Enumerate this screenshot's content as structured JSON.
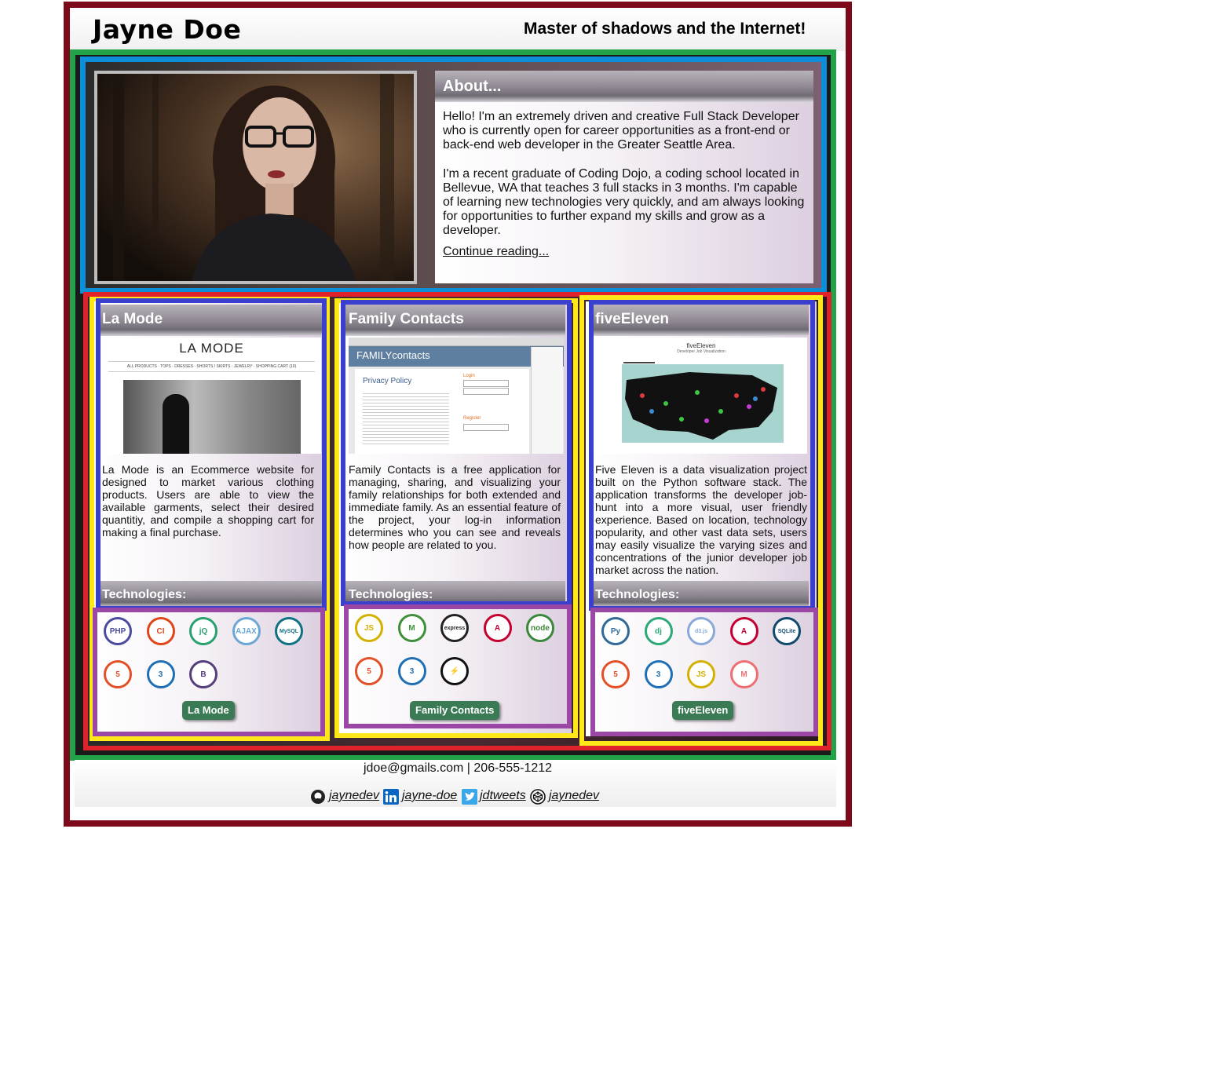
{
  "header": {
    "name": "Jayne Doe",
    "tagline": "Master of shadows and the Internet!"
  },
  "about": {
    "heading": "About...",
    "paragraph1": "Hello! I'm an extremely driven and creative Full Stack Developer who is currently open for career opportunities as a front-end or back-end web developer in the Greater Seattle Area.",
    "paragraph2": "I'm a recent graduate of Coding Dojo, a coding school located in Bellevue, WA that teaches 3 full stacks in 3 months. I'm capable of learning new technologies very quickly, and am always looking for opportunities to further expand my skills and grow as a developer.",
    "link_label": "Continue reading..."
  },
  "projects": [
    {
      "title": "La Mode",
      "description": "La Mode is an Ecommerce website for designed to market various clothing products. Users are able to view the available garments, select their desired quantitiy, and compile a shopping cart for making a final purchase.",
      "tech_heading": "Technologies:",
      "button": "La Mode",
      "screenshot": {
        "brand": "LA MODE",
        "nav": "ALL PRODUCTS · TOPS · DRESSES · SHORTS / SKIRTS · JEWELRY · SHOPPING CART (10)"
      },
      "icons": [
        {
          "name": "php-icon",
          "label": "PHP",
          "color": "#4a4aa0"
        },
        {
          "name": "codeigniter-icon",
          "label": "CI",
          "color": "#e0441a"
        },
        {
          "name": "jquery-icon",
          "label": "jQ",
          "color": "#2aa070"
        },
        {
          "name": "ajax-icon",
          "label": "AJAX",
          "color": "#6aa6d6"
        },
        {
          "name": "mysql-icon",
          "label": "MySQL",
          "color": "#127085"
        },
        {
          "name": "html5-icon",
          "label": "5",
          "color": "#e34f26"
        },
        {
          "name": "css3-icon",
          "label": "3",
          "color": "#1f6fb5"
        },
        {
          "name": "bootstrap-icon",
          "label": "B",
          "color": "#563d7c"
        }
      ]
    },
    {
      "title": "Family Contacts",
      "description": "Family Contacts is a free application for managing, sharing, and visualizing your family relationships for both extended and immediate family. As an essential feature of the project, your log-in information determines who you can see and reveals how people are related to you.",
      "tech_heading": "Technologies:",
      "button": "Family Contacts",
      "screenshot": {
        "brand": "FAMILYcontacts",
        "page_heading": "Privacy Policy",
        "login": "Login",
        "register": "Register"
      },
      "icons": [
        {
          "name": "javascript-icon",
          "label": "JS",
          "color": "#d4b000"
        },
        {
          "name": "mongodb-icon",
          "label": "M",
          "color": "#3f8f3a"
        },
        {
          "name": "express-icon",
          "label": "express",
          "color": "#222222"
        },
        {
          "name": "angular-icon",
          "label": "A",
          "color": "#c3002f"
        },
        {
          "name": "nodejs-icon",
          "label": "node",
          "color": "#3c873a"
        },
        {
          "name": "html5-icon",
          "label": "5",
          "color": "#e34f26"
        },
        {
          "name": "css3-icon",
          "label": "3",
          "color": "#1f6fb5"
        },
        {
          "name": "socketio-icon",
          "label": "⚡",
          "color": "#111111"
        }
      ]
    },
    {
      "title": "fiveEleven",
      "description": "Five Eleven is a data visualization project built on the Python software stack. The application transforms the developer job-hunt into a more visual, user friendly experience. Based on location, technology popularity, and other vast data sets, users may easily visualize the varying sizes and concentrations of the junior developer job market across the nation.",
      "tech_heading": "Technologies:",
      "button": "fiveEleven",
      "screenshot": {
        "brand": "fiveEleven",
        "subtitle": "Developer Job Visualization"
      },
      "icons": [
        {
          "name": "python-icon",
          "label": "Py",
          "color": "#306998"
        },
        {
          "name": "django-icon",
          "label": "dj",
          "color": "#2ba977"
        },
        {
          "name": "d3js-icon",
          "label": "d3.js",
          "color": "#8aa8d8"
        },
        {
          "name": "angular-icon",
          "label": "A",
          "color": "#c3002f"
        },
        {
          "name": "sqlite-icon",
          "label": "SQLite",
          "color": "#0f4b6e"
        },
        {
          "name": "html5-icon",
          "label": "5",
          "color": "#e34f26"
        },
        {
          "name": "css3-icon",
          "label": "3",
          "color": "#1f6fb5"
        },
        {
          "name": "javascript-icon",
          "label": "JS",
          "color": "#d4b000"
        },
        {
          "name": "materialize-icon",
          "label": "M",
          "color": "#ee6e73"
        }
      ]
    }
  ],
  "footer": {
    "contact": "jdoe@gmails.com | 206-555-1212",
    "social": [
      {
        "name": "github-link",
        "icon": "github-icon",
        "label": "jaynedev"
      },
      {
        "name": "linkedin-link",
        "icon": "linkedin-icon",
        "label": "jayne-doe"
      },
      {
        "name": "twitter-link",
        "icon": "twitter-icon",
        "label": "jdtweets"
      },
      {
        "name": "codepen-link",
        "icon": "codepen-icon",
        "label": "jaynedev"
      }
    ]
  }
}
